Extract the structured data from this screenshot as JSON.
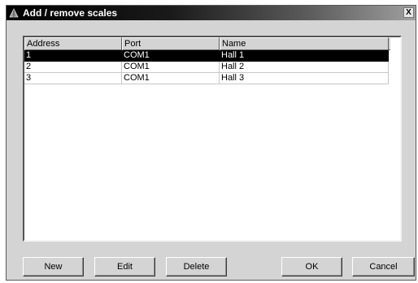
{
  "window": {
    "title": "Add / remove scales",
    "close_symbol": "X"
  },
  "icons": {
    "title_icon": "scale-icon",
    "close_icon": "close-icon"
  },
  "table": {
    "columns": [
      "Address",
      "Port",
      "Name"
    ],
    "rows": [
      {
        "address": "1",
        "port": "COM1",
        "name": "Hall 1",
        "selected": true
      },
      {
        "address": "2",
        "port": "COM1",
        "name": "Hall 2",
        "selected": false
      },
      {
        "address": "3",
        "port": "COM1",
        "name": "Hall 3",
        "selected": false
      }
    ]
  },
  "buttons": {
    "new": "New",
    "edit": "Edit",
    "delete": "Delete",
    "ok": "OK",
    "cancel": "Cancel"
  },
  "colors": {
    "selection_bg": "#000000",
    "selection_fg": "#ffffff",
    "dialog_bg": "#d4d4d4"
  }
}
